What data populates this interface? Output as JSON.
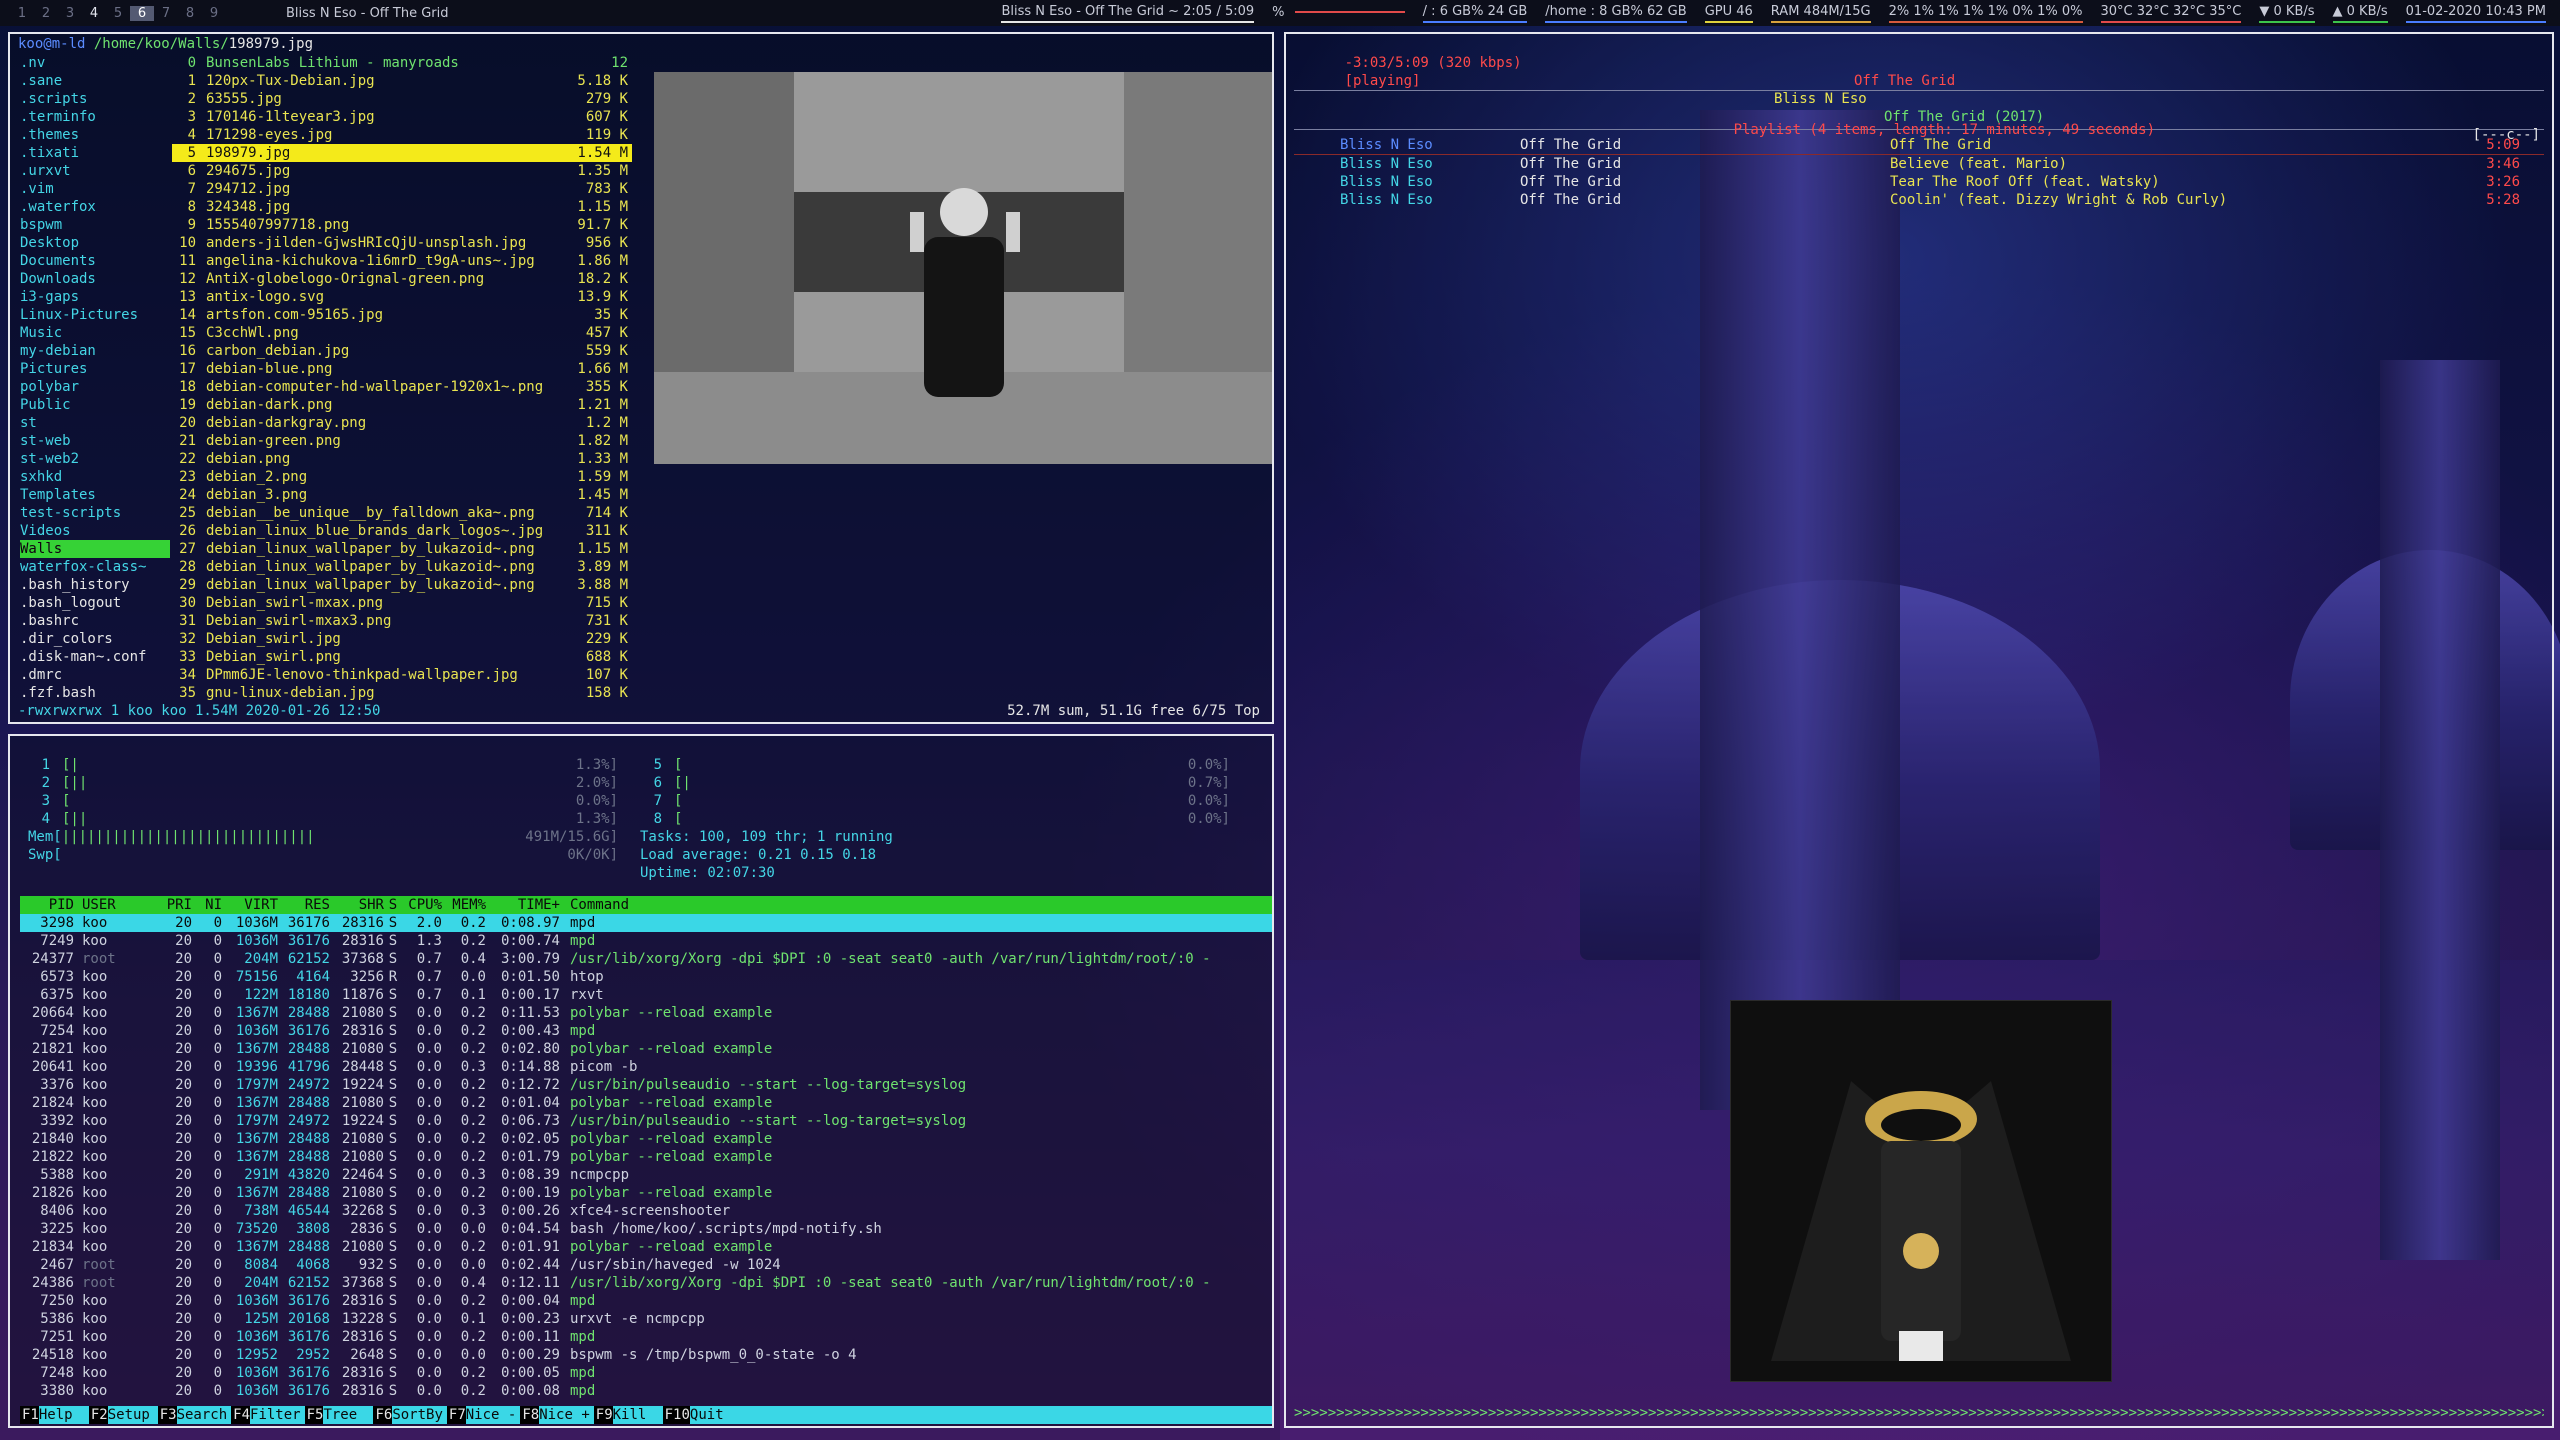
{
  "topbar": {
    "workspaces": [
      "1",
      "2",
      "3",
      "4",
      "5",
      "6",
      "7",
      "8",
      "9"
    ],
    "title": "Bliss N Eso - Off The Grid",
    "now_playing": "Bliss N Eso - Off The Grid  ~  2:05 / 5:09",
    "volume": "%",
    "disk_root": "/ : 6 GB% 24 GB",
    "disk_home": "/home : 8 GB% 62 GB",
    "gpu": "GPU 46",
    "ram": "RAM 484M/15G",
    "cpu": "2% 1% 1% 1% 1% 0% 1% 0%",
    "temps": "30°C  32°C  32°C  35°C",
    "net_down": "0 KB/s",
    "net_up": "0 KB/s",
    "clock": "01-02-2020 10:43 PM"
  },
  "ranger": {
    "path_host": "koo@m-ld",
    "path": "/home/koo/Walls/",
    "path_file": "198979.jpg",
    "left": [
      ".nv",
      ".sane",
      ".scripts",
      ".terminfo",
      ".themes",
      ".tixati",
      ".urxvt",
      ".vim",
      ".waterfox",
      "bspwm",
      "Desktop",
      "Documents",
      "Downloads",
      "i3-gaps",
      "Linux-Pictures",
      "Music",
      "my-debian",
      "Pictures",
      "polybar",
      "Public",
      "st",
      "st-web",
      "st-web2",
      "sxhkd",
      "Templates",
      "test-scripts",
      "Videos",
      "Walls",
      "waterfox-class~",
      ".bash_history",
      ".bash_logout",
      ".bashrc",
      ".dir_colors",
      ".disk-man~.conf",
      ".dmrc",
      ".fzf.bash"
    ],
    "files": [
      {
        "n": "0",
        "name": "BunsenLabs Lithium - manyroads",
        "size": "12"
      },
      {
        "n": "1",
        "name": "120px-Tux-Debian.jpg",
        "size": "5.18 K"
      },
      {
        "n": "2",
        "name": "63555.jpg",
        "size": "279 K"
      },
      {
        "n": "3",
        "name": "170146-1lteyear3.jpg",
        "size": "607 K"
      },
      {
        "n": "4",
        "name": "171298-eyes.jpg",
        "size": "119 K"
      },
      {
        "n": "5",
        "name": "198979.jpg",
        "size": "1.54 M"
      },
      {
        "n": "6",
        "name": "294675.jpg",
        "size": "1.35 M"
      },
      {
        "n": "7",
        "name": "294712.jpg",
        "size": "783 K"
      },
      {
        "n": "8",
        "name": "324348.jpg",
        "size": "1.15 M"
      },
      {
        "n": "9",
        "name": "1555407997718.png",
        "size": "91.7 K"
      },
      {
        "n": "10",
        "name": "anders-jilden-GjwsHRIcQjU-unsplash.jpg",
        "size": "956 K"
      },
      {
        "n": "11",
        "name": "angelina-kichukova-1i6mrD_t9gA-uns~.jpg",
        "size": "1.86 M"
      },
      {
        "n": "12",
        "name": "AntiX-globelogo-Orignal-green.png",
        "size": "18.2 K"
      },
      {
        "n": "13",
        "name": "antix-logo.svg",
        "size": "13.9 K"
      },
      {
        "n": "14",
        "name": "artsfon.com-95165.jpg",
        "size": "35 K"
      },
      {
        "n": "15",
        "name": "C3cchWl.png",
        "size": "457 K"
      },
      {
        "n": "16",
        "name": "carbon_debian.jpg",
        "size": "559 K"
      },
      {
        "n": "17",
        "name": "debian-blue.png",
        "size": "1.66 M"
      },
      {
        "n": "18",
        "name": "debian-computer-hd-wallpaper-1920x1~.png",
        "size": "355 K"
      },
      {
        "n": "19",
        "name": "debian-dark.png",
        "size": "1.21 M"
      },
      {
        "n": "20",
        "name": "debian-darkgray.png",
        "size": "1.2 M"
      },
      {
        "n": "21",
        "name": "debian-green.png",
        "size": "1.82 M"
      },
      {
        "n": "22",
        "name": "debian.png",
        "size": "1.33 M"
      },
      {
        "n": "23",
        "name": "debian_2.png",
        "size": "1.59 M"
      },
      {
        "n": "24",
        "name": "debian_3.png",
        "size": "1.45 M"
      },
      {
        "n": "25",
        "name": "debian__be_unique__by_falldown_aka~.png",
        "size": "714 K"
      },
      {
        "n": "26",
        "name": "debian_linux_blue_brands_dark_logos~.jpg",
        "size": "311 K"
      },
      {
        "n": "27",
        "name": "debian_linux_wallpaper_by_lukazoid~.png",
        "size": "1.15 M"
      },
      {
        "n": "28",
        "name": "debian_linux_wallpaper_by_lukazoid~.png",
        "size": "3.89 M"
      },
      {
        "n": "29",
        "name": "debian_linux_wallpaper_by_lukazoid~.png",
        "size": "3.88 M"
      },
      {
        "n": "30",
        "name": "Debian_swirl-mxax.png",
        "size": "715 K"
      },
      {
        "n": "31",
        "name": "Debian_swirl-mxax3.png",
        "size": "731 K"
      },
      {
        "n": "32",
        "name": "Debian_swirl.jpg",
        "size": "229 K"
      },
      {
        "n": "33",
        "name": "Debian_swirl.png",
        "size": "688 K"
      },
      {
        "n": "34",
        "name": "DPmm6JE-lenovo-thinkpad-wallpaper.jpg",
        "size": "107 K"
      },
      {
        "n": "35",
        "name": "gnu-linux-debian.jpg",
        "size": "158 K"
      }
    ],
    "footer_left": "-rwxrwxrwx 1 koo koo 1.54M 2020-01-26 12:50",
    "footer_right": "52.7M sum, 51.1G free  6/75  Top"
  },
  "htop": {
    "cpus": [
      {
        "id": "1",
        "bar": "[|",
        "pct": "1.3%]"
      },
      {
        "id": "2",
        "bar": "[||",
        "pct": "2.0%]"
      },
      {
        "id": "3",
        "bar": "[",
        "pct": "0.0%]"
      },
      {
        "id": "4",
        "bar": "[||",
        "pct": "1.3%]"
      },
      {
        "id": "5",
        "bar": "[",
        "pct": "0.0%]"
      },
      {
        "id": "6",
        "bar": "[|",
        "pct": "0.7%]"
      },
      {
        "id": "7",
        "bar": "[",
        "pct": "0.0%]"
      },
      {
        "id": "8",
        "bar": "[",
        "pct": "0.0%]"
      }
    ],
    "mem": "491M/15.6G]",
    "swp": "0K/0K]",
    "tasks": "Tasks: 100, 109 thr; 1 running",
    "load": "Load average: 0.21 0.15 0.18",
    "uptime": "Uptime: 02:07:30",
    "header": [
      "PID",
      "USER",
      "PRI",
      "NI",
      "VIRT",
      "RES",
      "SHR",
      "S",
      "CPU%",
      "MEM%",
      "TIME+",
      "Command"
    ],
    "rows": [
      [
        "3298",
        "koo",
        "20",
        "0",
        "1036M",
        "36176",
        "28316",
        "S",
        "2.0",
        "0.2",
        "0:08.97",
        "mpd"
      ],
      [
        "7249",
        "koo",
        "20",
        "0",
        "1036M",
        "36176",
        "28316",
        "S",
        "1.3",
        "0.2",
        "0:00.74",
        "mpd"
      ],
      [
        "24377",
        "root",
        "20",
        "0",
        "204M",
        "62152",
        "37368",
        "S",
        "0.7",
        "0.4",
        "3:00.79",
        "/usr/lib/xorg/Xorg -dpi $DPI :0 -seat seat0 -auth /var/run/lightdm/root/:0 -"
      ],
      [
        "6573",
        "koo",
        "20",
        "0",
        "75156",
        "4164",
        "3256",
        "R",
        "0.7",
        "0.0",
        "0:01.50",
        "htop"
      ],
      [
        "6375",
        "koo",
        "20",
        "0",
        "122M",
        "18180",
        "11876",
        "S",
        "0.7",
        "0.1",
        "0:00.17",
        "rxvt"
      ],
      [
        "20664",
        "koo",
        "20",
        "0",
        "1367M",
        "28488",
        "21080",
        "S",
        "0.0",
        "0.2",
        "0:11.53",
        "polybar --reload example"
      ],
      [
        "7254",
        "koo",
        "20",
        "0",
        "1036M",
        "36176",
        "28316",
        "S",
        "0.0",
        "0.2",
        "0:00.43",
        "mpd"
      ],
      [
        "21821",
        "koo",
        "20",
        "0",
        "1367M",
        "28488",
        "21080",
        "S",
        "0.0",
        "0.2",
        "0:02.80",
        "polybar --reload example"
      ],
      [
        "20641",
        "koo",
        "20",
        "0",
        "19396",
        "41796",
        "28448",
        "S",
        "0.0",
        "0.3",
        "0:14.88",
        "picom -b"
      ],
      [
        "3376",
        "koo",
        "20",
        "0",
        "1797M",
        "24972",
        "19224",
        "S",
        "0.0",
        "0.2",
        "0:12.72",
        "/usr/bin/pulseaudio --start --log-target=syslog"
      ],
      [
        "21824",
        "koo",
        "20",
        "0",
        "1367M",
        "28488",
        "21080",
        "S",
        "0.0",
        "0.2",
        "0:01.04",
        "polybar --reload example"
      ],
      [
        "3392",
        "koo",
        "20",
        "0",
        "1797M",
        "24972",
        "19224",
        "S",
        "0.0",
        "0.2",
        "0:06.73",
        "/usr/bin/pulseaudio --start --log-target=syslog"
      ],
      [
        "21840",
        "koo",
        "20",
        "0",
        "1367M",
        "28488",
        "21080",
        "S",
        "0.0",
        "0.2",
        "0:02.05",
        "polybar --reload example"
      ],
      [
        "21822",
        "koo",
        "20",
        "0",
        "1367M",
        "28488",
        "21080",
        "S",
        "0.0",
        "0.2",
        "0:01.79",
        "polybar --reload example"
      ],
      [
        "5388",
        "koo",
        "20",
        "0",
        "291M",
        "43820",
        "22464",
        "S",
        "0.0",
        "0.3",
        "0:08.39",
        "ncmpcpp"
      ],
      [
        "21826",
        "koo",
        "20",
        "0",
        "1367M",
        "28488",
        "21080",
        "S",
        "0.0",
        "0.2",
        "0:00.19",
        "polybar --reload example"
      ],
      [
        "8406",
        "koo",
        "20",
        "0",
        "738M",
        "46544",
        "32268",
        "S",
        "0.0",
        "0.3",
        "0:00.26",
        "xfce4-screenshooter"
      ],
      [
        "3225",
        "koo",
        "20",
        "0",
        "73520",
        "3808",
        "2836",
        "S",
        "0.0",
        "0.0",
        "0:04.54",
        "bash /home/koo/.scripts/mpd-notify.sh"
      ],
      [
        "21834",
        "koo",
        "20",
        "0",
        "1367M",
        "28488",
        "21080",
        "S",
        "0.0",
        "0.2",
        "0:01.91",
        "polybar --reload example"
      ],
      [
        "2467",
        "root",
        "20",
        "0",
        "8084",
        "4068",
        "932",
        "S",
        "0.0",
        "0.0",
        "0:02.44",
        "/usr/sbin/haveged -w 1024"
      ],
      [
        "24386",
        "root",
        "20",
        "0",
        "204M",
        "62152",
        "37368",
        "S",
        "0.0",
        "0.4",
        "0:12.11",
        "/usr/lib/xorg/Xorg -dpi $DPI :0 -seat seat0 -auth /var/run/lightdm/root/:0 -"
      ],
      [
        "7250",
        "koo",
        "20",
        "0",
        "1036M",
        "36176",
        "28316",
        "S",
        "0.0",
        "0.2",
        "0:00.04",
        "mpd"
      ],
      [
        "5386",
        "koo",
        "20",
        "0",
        "125M",
        "20168",
        "13228",
        "S",
        "0.0",
        "0.1",
        "0:00.23",
        "urxvt -e ncmpcpp"
      ],
      [
        "7251",
        "koo",
        "20",
        "0",
        "1036M",
        "36176",
        "28316",
        "S",
        "0.0",
        "0.2",
        "0:00.11",
        "mpd"
      ],
      [
        "24518",
        "koo",
        "20",
        "0",
        "12952",
        "2952",
        "2648",
        "S",
        "0.0",
        "0.0",
        "0:00.29",
        "bspwm -s /tmp/bspwm_0_0-state -o 4"
      ],
      [
        "7248",
        "koo",
        "20",
        "0",
        "1036M",
        "36176",
        "28316",
        "S",
        "0.0",
        "0.2",
        "0:00.05",
        "mpd"
      ],
      [
        "3380",
        "koo",
        "20",
        "0",
        "1036M",
        "36176",
        "28316",
        "S",
        "0.0",
        "0.2",
        "0:00.08",
        "mpd"
      ]
    ],
    "fkeys": [
      {
        "k": "F1",
        "l": "Help"
      },
      {
        "k": "F2",
        "l": "Setup"
      },
      {
        "k": "F3",
        "l": "Search"
      },
      {
        "k": "F4",
        "l": "Filter"
      },
      {
        "k": "F5",
        "l": "Tree"
      },
      {
        "k": "F6",
        "l": "SortBy"
      },
      {
        "k": "F7",
        "l": "Nice -"
      },
      {
        "k": "F8",
        "l": "Nice +"
      },
      {
        "k": "F9",
        "l": "Kill"
      },
      {
        "k": "F10",
        "l": "Quit"
      }
    ]
  },
  "ncmpcpp": {
    "time": "-3:03/5:09 (320 kbps)",
    "state": "[playing]",
    "song_title": "Off The Grid",
    "artist": "Bliss N Eso",
    "album_line": "Off The Grid (2017)",
    "flags": "[---c--]",
    "playlist_header": "Playlist (4 items, length: 17 minutes, 49 seconds)",
    "playlist": [
      {
        "artist": "Bliss N Eso",
        "album": "Off The Grid",
        "title": "Off The Grid",
        "dur": "5:09"
      },
      {
        "artist": "Bliss N Eso",
        "album": "Off The Grid",
        "title": "Believe (feat. Mario)",
        "dur": "3:46"
      },
      {
        "artist": "Bliss N Eso",
        "album": "Off The Grid",
        "title": "Tear The Roof Off (feat. Watsky)",
        "dur": "3:26"
      },
      {
        "artist": "Bliss N Eso",
        "album": "Off The Grid",
        "title": "Coolin' (feat. Dizzy Wright & Rob Curly)",
        "dur": "5:28"
      }
    ],
    "progress": 0.41,
    "progress_glyphs": ">>>>>>>>>>>>>>>>>>>>>>>>>>>>>>>>>>>>>>>>>>>>>>>>>>>>>>>>>>>>>>>>>>>>>>>>>>>>>>>>>>>>>>>>>>>>>>>>>>>>>>>>>>>>>>>>>>>>>>>>>>>>>>>>>>>>>>>>>>>>>>>>>>>>>>>>>>>>>>>>>>>>>>>>>>>>>>>>>>>>>>>>>>>>>>>>>>>>>>>>>"
  },
  "colors": {
    "accent_green": "#6fe36f",
    "accent_yellow": "#e9e451",
    "accent_cyan": "#44d6e6",
    "accent_red": "#ff4a4a"
  }
}
